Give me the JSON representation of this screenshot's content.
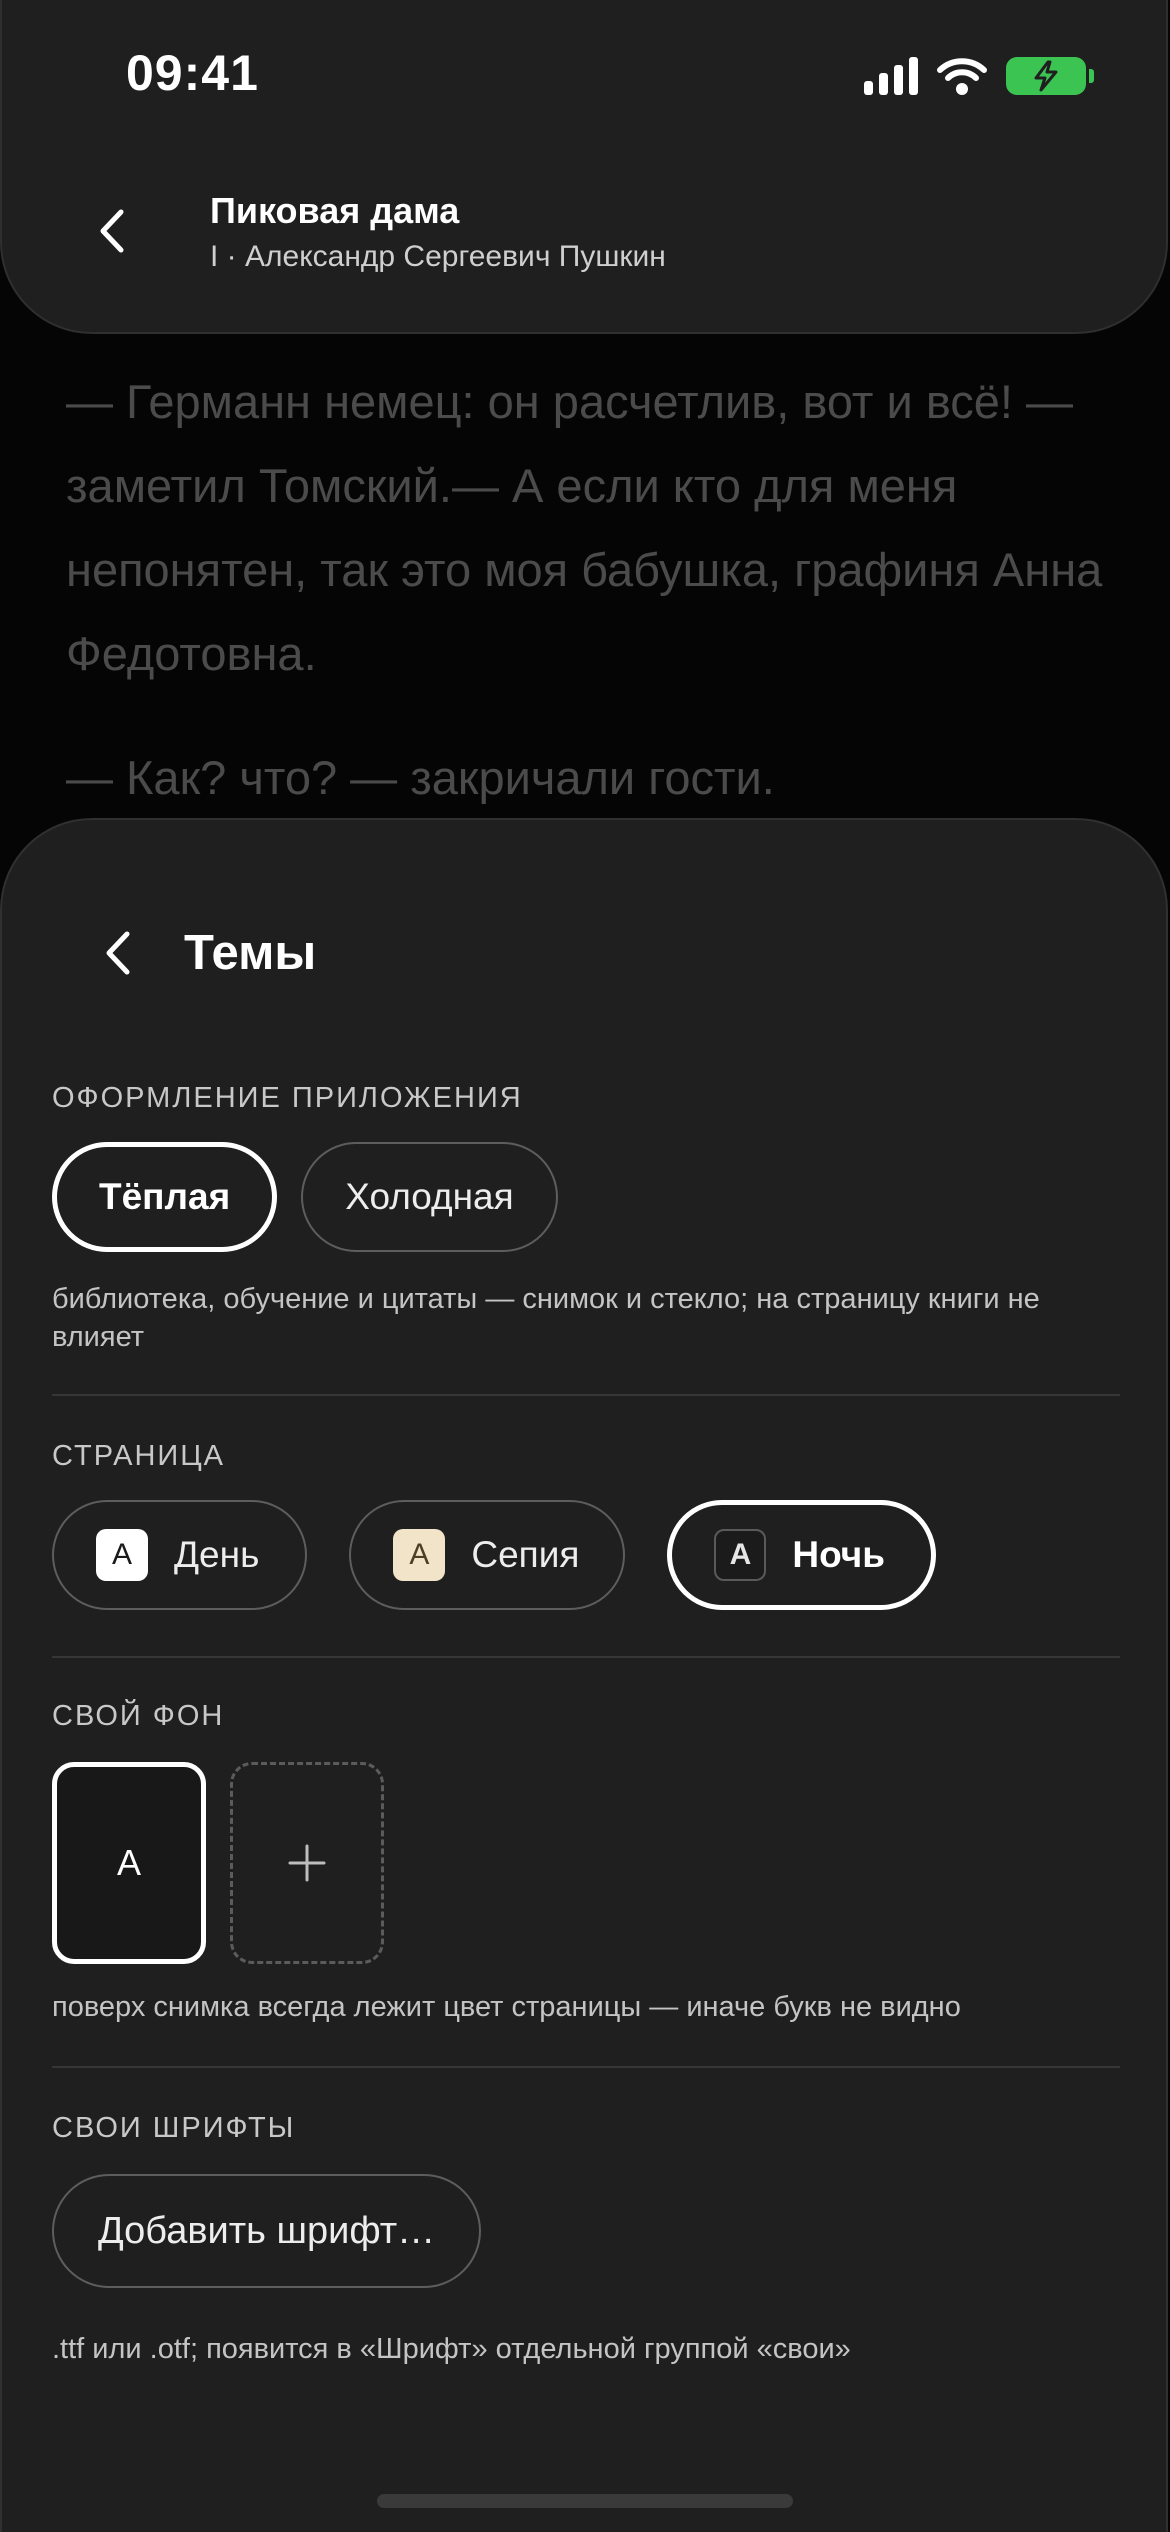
{
  "status_bar": {
    "time": "09:41"
  },
  "header": {
    "title": "Пиковая дама",
    "subtitle": "I · Александр Сергеевич Пушкин",
    "back_icon": "chevron-left-icon"
  },
  "reader": {
    "paragraphs": [
      "— Германн немец: он расчетлив, вот и всё! — заметил Томский.— А если кто для меня непонятен, так это моя бабушка, графиня Анна Федотовна.",
      "— Как? что? — закричали гости."
    ]
  },
  "sheet": {
    "title": "Темы",
    "back_icon": "chevron-left-icon",
    "app_theme": {
      "label": "ОФОРМЛЕНИЕ ПРИЛОЖЕНИЯ",
      "options": [
        "Тёплая",
        "Холодная"
      ],
      "selected": "Тёплая",
      "hint": "библиотека, обучение и цитаты — снимок и стекло; на страницу книги не влияет"
    },
    "page": {
      "label": "СТРАНИЦА",
      "swatch_letter": "A",
      "options": [
        {
          "label": "День",
          "bg": "#ffffff"
        },
        {
          "label": "Сепия",
          "bg": "#f1e4c8"
        },
        {
          "label": "Ночь",
          "bg": "#1b1b1b"
        }
      ],
      "selected": "Ночь"
    },
    "custom_bg": {
      "label": "СВОЙ ФОН",
      "tile_letter": "A",
      "add_symbol": "+",
      "hint": "поверх снимка всегда лежит цвет страницы — иначе букв не видно"
    },
    "custom_fonts": {
      "label": "СВОИ ШРИФТЫ",
      "button_label": "Добавить шрифт…",
      "hint": ".ttf или .otf; появится в «Шрифт» отдельной группой «свои»"
    }
  },
  "colors": {
    "sheet_bg": "#1f1f1f",
    "battery": "#3cc453",
    "selected_border": "#ffffff"
  }
}
